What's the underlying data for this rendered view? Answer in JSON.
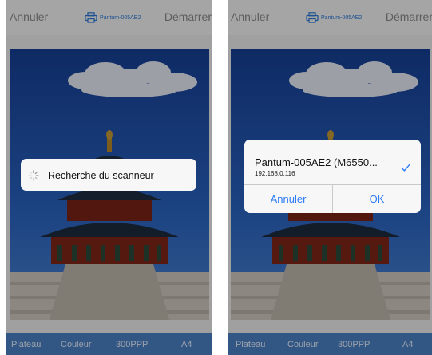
{
  "colors": {
    "accent": "#2b78d8",
    "bottom_bar": "#4a80c4",
    "sky": "#1d4fa8"
  },
  "left_screen": {
    "topbar": {
      "cancel_label": "Annuler",
      "printer_name": "Pantum-005AE2",
      "start_label": "Démarrer",
      "printer_icon": "printer-icon"
    },
    "toast": {
      "message": "Recherche du scanneur",
      "icon": "spinner-icon"
    },
    "bottombar": {
      "source": "Plateau",
      "color_mode": "Couleur",
      "resolution": "300PPP",
      "paper": "A4"
    }
  },
  "right_screen": {
    "topbar": {
      "cancel_label": "Annuler",
      "printer_name": "Pantum-005AE2",
      "start_label": "Démarrer",
      "printer_icon": "printer-icon"
    },
    "dialog": {
      "device_name": "Pantum-005AE2 (M6550...",
      "device_ip": "192.168.0.116",
      "selected_icon": "checkmark-icon",
      "cancel_label": "Annuler",
      "ok_label": "OK"
    },
    "bottombar": {
      "source": "Plateau",
      "color_mode": "Couleur",
      "resolution": "300PPP",
      "paper": "A4"
    }
  }
}
